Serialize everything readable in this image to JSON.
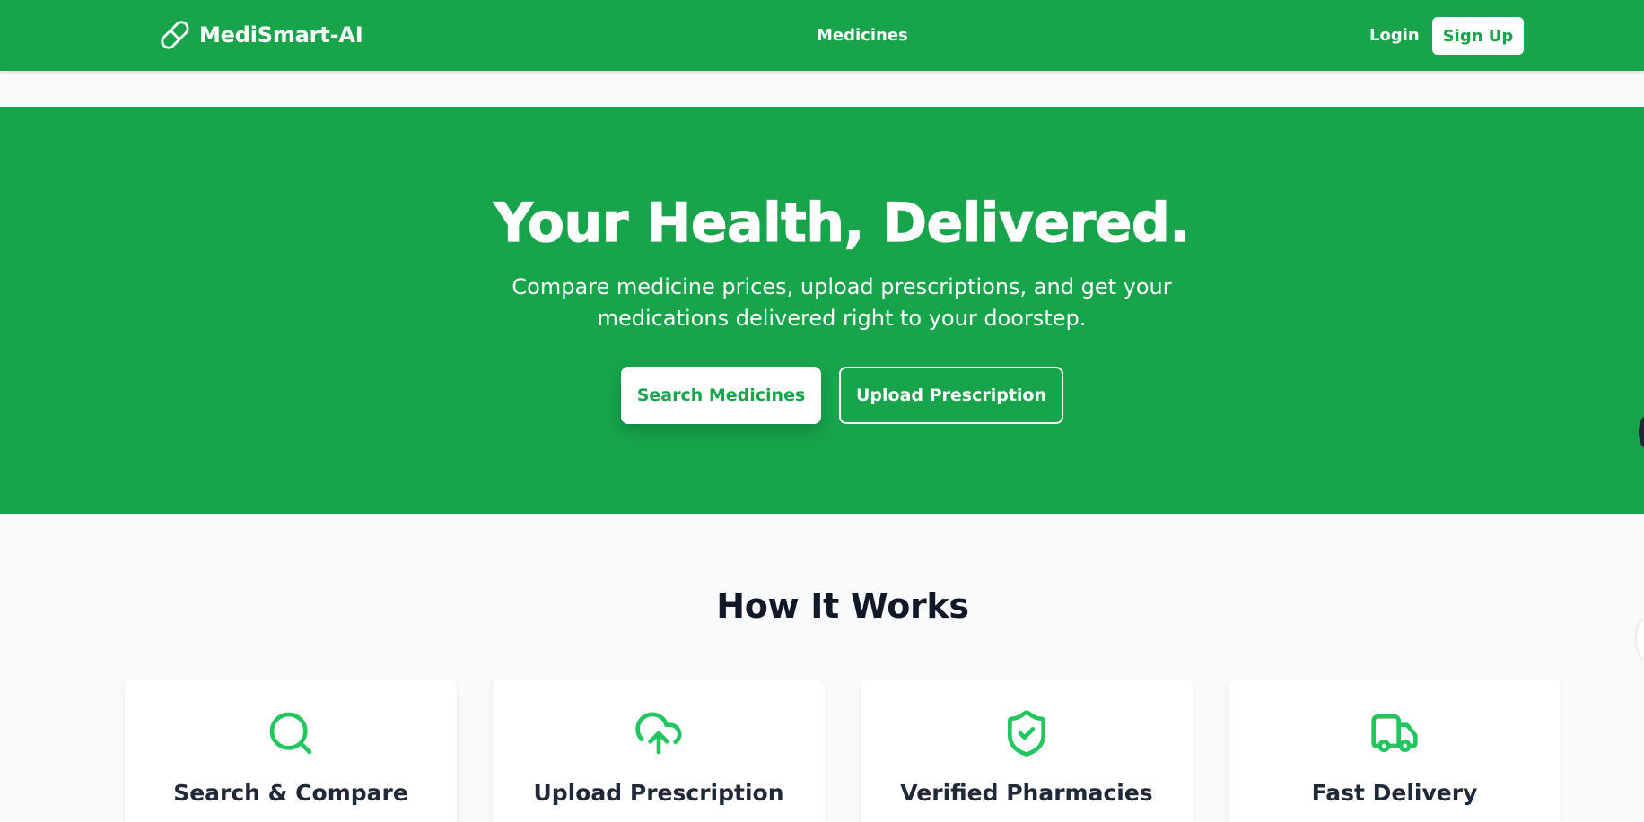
{
  "navbar": {
    "brand": "MediSmart-AI",
    "brand_icon": "pill-icon",
    "center_link": "Medicines",
    "login": "Login",
    "signup": "Sign Up"
  },
  "hero": {
    "title": "Your Health, Delivered.",
    "subtitle": "Compare medicine prices, upload prescriptions, and get your medications delivered right to your doorstep.",
    "primary_button": "Search Medicines",
    "secondary_button": "Upload Prescription"
  },
  "how_it_works": {
    "title": "How It Works",
    "cards": [
      {
        "icon": "search-icon",
        "title": "Search & Compare"
      },
      {
        "icon": "cloud-upload-icon",
        "title": "Upload Prescription"
      },
      {
        "icon": "shield-check-icon",
        "title": "Verified Pharmacies"
      },
      {
        "icon": "truck-icon",
        "title": "Fast Delivery"
      }
    ]
  },
  "colors": {
    "brand_green": "#18a44b",
    "icon_green": "#22c55e",
    "page_background": "#f8fafc",
    "heading_text": "#111827"
  }
}
